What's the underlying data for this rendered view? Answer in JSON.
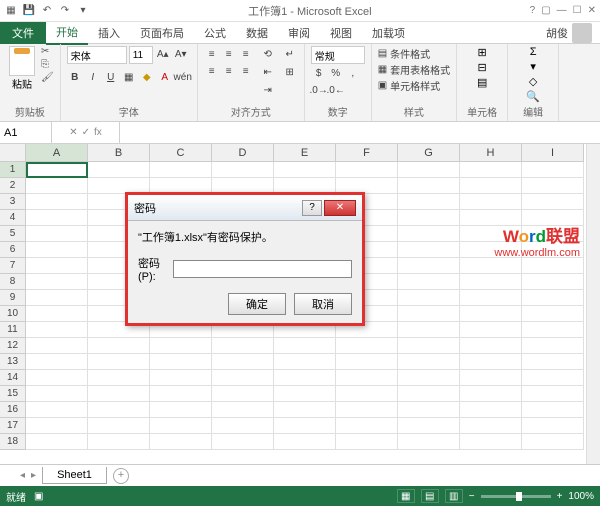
{
  "titlebar": {
    "title": "工作簿1 - Microsoft Excel"
  },
  "tabs": {
    "file": "文件",
    "items": [
      "开始",
      "插入",
      "页面布局",
      "公式",
      "数据",
      "审阅",
      "视图",
      "加载项"
    ],
    "active": 0,
    "account": "胡俊"
  },
  "ribbon": {
    "clipboard": {
      "label": "剪贴板",
      "paste": "粘贴"
    },
    "font": {
      "label": "字体",
      "name": "宋体",
      "size": "11"
    },
    "alignment": {
      "label": "对齐方式"
    },
    "number": {
      "label": "数字",
      "format": "常规"
    },
    "styles": {
      "label": "样式",
      "cond": "条件格式",
      "table": "套用表格格式",
      "cell": "单元格样式"
    },
    "cells": {
      "label": "单元格"
    },
    "editing": {
      "label": "编辑"
    }
  },
  "formula_bar": {
    "name_box": "A1",
    "fx": "fx"
  },
  "grid": {
    "columns": [
      "A",
      "B",
      "C",
      "D",
      "E",
      "F",
      "G",
      "H",
      "I"
    ],
    "rows": [
      1,
      2,
      3,
      4,
      5,
      6,
      7,
      8,
      9,
      10,
      11,
      12,
      13,
      14,
      15,
      16,
      17,
      18
    ],
    "active": "A1"
  },
  "dialog": {
    "title": "密码",
    "message": "\"工作簿1.xlsx\"有密码保护。",
    "label": "密码(P):",
    "ok": "确定",
    "cancel": "取消"
  },
  "watermark": {
    "line1_plain": "Word",
    "line1_cn": "联盟",
    "line2": "www.wordlm.com"
  },
  "sheets": {
    "tab": "Sheet1"
  },
  "status": {
    "ready": "就绪",
    "zoom": "100%"
  }
}
